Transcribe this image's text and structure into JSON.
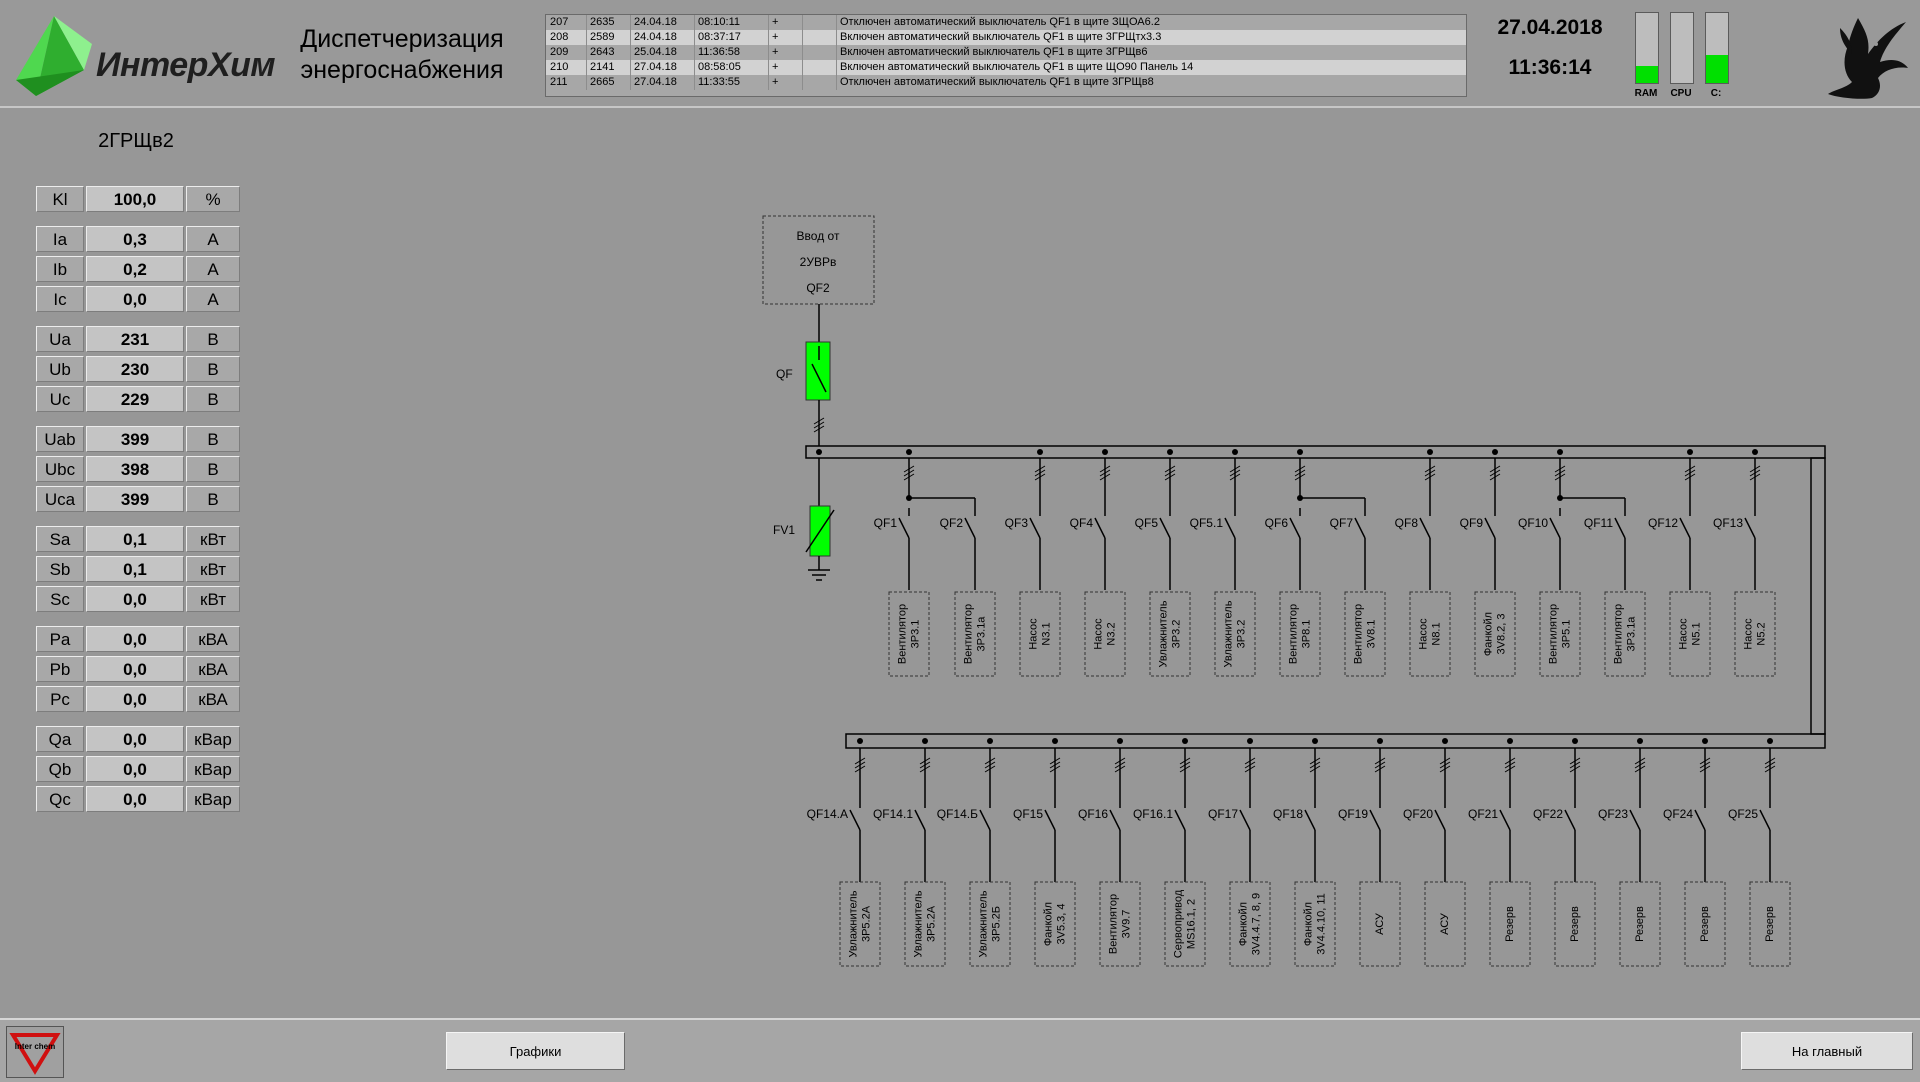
{
  "header": {
    "logo_text": "ИнтерХим",
    "app_title": "Диспетчеризация энергоснабжения",
    "date": "27.04.2018",
    "time": "11:36:14",
    "meters": [
      {
        "label": "RAM",
        "level_percent": 25
      },
      {
        "label": "CPU",
        "level_percent": 0
      },
      {
        "label": "C:",
        "level_percent": 40
      }
    ]
  },
  "event_log": [
    {
      "n": "207",
      "id": "2635",
      "date": "24.04.18",
      "time": "08:10:11",
      "flag": "+",
      "message": "Отключен автоматический выключатель QF1 в щите ЗЩОА6.2"
    },
    {
      "n": "208",
      "id": "2589",
      "date": "24.04.18",
      "time": "08:37:17",
      "flag": "+",
      "message": "Включен автоматический выключатель QF1 в щите 3ГРЩтх3.3"
    },
    {
      "n": "209",
      "id": "2643",
      "date": "25.04.18",
      "time": "11:36:58",
      "flag": "+",
      "message": "Включен автоматический выключатель QF1 в щите 3ГРЩв6"
    },
    {
      "n": "210",
      "id": "2141",
      "date": "27.04.18",
      "time": "08:58:05",
      "flag": "+",
      "message": "Включен автоматический выключатель QF1 в щите ЩО90 Панель 14"
    },
    {
      "n": "211",
      "id": "2665",
      "date": "27.04.18",
      "time": "11:33:55",
      "flag": "+",
      "message": "Отключен автоматический выключатель QF1 в щите 3ГРЩв8"
    }
  ],
  "panel": {
    "title": "2ГРЩв2",
    "params": [
      {
        "name": "Kl",
        "value": "100,0",
        "unit": "%"
      },
      {
        "name": "Ia",
        "value": "0,3",
        "unit": "A"
      },
      {
        "name": "Ib",
        "value": "0,2",
        "unit": "A"
      },
      {
        "name": "Ic",
        "value": "0,0",
        "unit": "A"
      },
      {
        "name": "Ua",
        "value": "231",
        "unit": "В"
      },
      {
        "name": "Ub",
        "value": "230",
        "unit": "В"
      },
      {
        "name": "Uc",
        "value": "229",
        "unit": "В"
      },
      {
        "name": "Uab",
        "value": "399",
        "unit": "В"
      },
      {
        "name": "Ubc",
        "value": "398",
        "unit": "В"
      },
      {
        "name": "Uca",
        "value": "399",
        "unit": "В"
      },
      {
        "name": "Sa",
        "value": "0,1",
        "unit": "кВт"
      },
      {
        "name": "Sb",
        "value": "0,1",
        "unit": "кВт"
      },
      {
        "name": "Sc",
        "value": "0,0",
        "unit": "кВт"
      },
      {
        "name": "Pa",
        "value": "0,0",
        "unit": "кВА"
      },
      {
        "name": "Pb",
        "value": "0,0",
        "unit": "кВА"
      },
      {
        "name": "Pc",
        "value": "0,0",
        "unit": "кВА"
      },
      {
        "name": "Qa",
        "value": "0,0",
        "unit": "кВар"
      },
      {
        "name": "Qb",
        "value": "0,0",
        "unit": "кВар"
      },
      {
        "name": "Qc",
        "value": "0,0",
        "unit": "кВар"
      }
    ]
  },
  "diagram": {
    "input_lines": [
      "Ввод от",
      "2УВРв",
      "QF2"
    ],
    "main_breaker_label": "QF",
    "surge_protector_label": "FV1",
    "active_color": "#00ff00",
    "upper_feeders": [
      {
        "breaker": "QF1",
        "load": [
          "Вентилятор",
          "3Р3.1"
        ]
      },
      {
        "breaker": "QF2",
        "load": [
          "Вентилятор",
          "3Р3.1а"
        ]
      },
      {
        "breaker": "QF3",
        "load": [
          "Насос",
          "N3.1"
        ]
      },
      {
        "breaker": "QF4",
        "load": [
          "Насос",
          "N3.2"
        ]
      },
      {
        "breaker": "QF5",
        "load": [
          "Увлажнитель",
          "3Р3.2"
        ]
      },
      {
        "breaker": "QF5.1",
        "load": [
          "Увлажнитель",
          "3Р3.2"
        ]
      },
      {
        "breaker": "QF6",
        "load": [
          "Вентилятор",
          "3Р8.1"
        ]
      },
      {
        "breaker": "QF7",
        "load": [
          "Вентилятор",
          "3V8.1"
        ]
      },
      {
        "breaker": "QF8",
        "load": [
          "Насос",
          "N8.1"
        ]
      },
      {
        "breaker": "QF9",
        "load": [
          "Фанкойл",
          "3V8.2, 3"
        ]
      },
      {
        "breaker": "QF10",
        "load": [
          "Вентилятор",
          "3Р5.1"
        ]
      },
      {
        "breaker": "QF11",
        "load": [
          "Вентилятор",
          "3Р3.1а"
        ]
      },
      {
        "breaker": "QF12",
        "load": [
          "Насос",
          "N5.1"
        ]
      },
      {
        "breaker": "QF13",
        "load": [
          "Насос",
          "N5.2"
        ]
      }
    ],
    "lower_feeders": [
      {
        "breaker": "QF14.А",
        "load": [
          "Увлажнитель",
          "3Р5.2А"
        ]
      },
      {
        "breaker": "QF14.1",
        "load": [
          "Увлажнитель",
          "3Р5.2А"
        ]
      },
      {
        "breaker": "QF14.Б",
        "load": [
          "Увлажнитель",
          "3Р5.2Б"
        ]
      },
      {
        "breaker": "QF15",
        "load": [
          "Фанкойл",
          "3V5.3, 4"
        ]
      },
      {
        "breaker": "QF16",
        "load": [
          "Вентилятор",
          "3V9.7"
        ]
      },
      {
        "breaker": "QF16.1",
        "load": [
          "Сервопривод",
          "MS16.1, 2"
        ]
      },
      {
        "breaker": "QF17",
        "load": [
          "Фанкойл",
          "3V4.4.7, 8, 9"
        ]
      },
      {
        "breaker": "QF18",
        "load": [
          "Фанкойл",
          "3V4.4.10, 11"
        ]
      },
      {
        "breaker": "QF19",
        "load": [
          "АСУ"
        ]
      },
      {
        "breaker": "QF20",
        "load": [
          "АСУ"
        ]
      },
      {
        "breaker": "QF21",
        "load": [
          "Резерв"
        ]
      },
      {
        "breaker": "QF22",
        "load": [
          "Резерв"
        ]
      },
      {
        "breaker": "QF23",
        "load": [
          "Резерв"
        ]
      },
      {
        "breaker": "QF24",
        "load": [
          "Резерв"
        ]
      },
      {
        "breaker": "QF25",
        "load": [
          "Резерв"
        ]
      }
    ]
  },
  "footer": {
    "footer_logo_text": "Inter chem",
    "charts_button": "Графики",
    "home_button": "На главный"
  }
}
